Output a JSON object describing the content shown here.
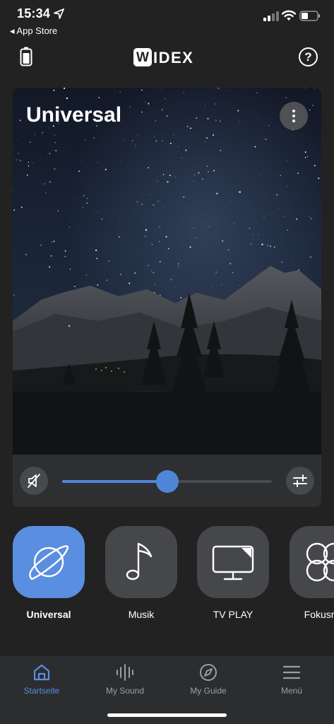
{
  "status_bar": {
    "time": "15:34",
    "back_app": "◂ App Store",
    "icons": [
      "location-arrow-icon",
      "cellular-signal-icon",
      "wifi-icon",
      "battery-icon"
    ]
  },
  "header": {
    "logo_initial": "W",
    "logo_text": "IDEX",
    "help_label": "?",
    "icons": [
      "hearing-aid-battery-icon",
      "help-icon"
    ]
  },
  "program_card": {
    "title": "Universal",
    "volume_level": 0.5,
    "icons": [
      "more-vertical-icon",
      "speaker-mute-icon",
      "equalizer-sliders-icon"
    ]
  },
  "programs": [
    {
      "label": "Universal",
      "icon": "planet-icon",
      "active": true
    },
    {
      "label": "Musik",
      "icon": "music-note-icon",
      "active": false
    },
    {
      "label": "TV PLAY",
      "icon": "tv-icon",
      "active": false
    },
    {
      "label": "Fokusrich",
      "icon": "focus-icon",
      "active": false
    }
  ],
  "nav": {
    "items": [
      {
        "label": "Startseite",
        "icon": "home-icon",
        "active": true
      },
      {
        "label": "My Sound",
        "icon": "sound-wave-icon",
        "active": false
      },
      {
        "label": "My Guide",
        "icon": "compass-icon",
        "active": false
      },
      {
        "label": "Menü",
        "icon": "menu-icon",
        "active": false
      }
    ]
  },
  "colors": {
    "accent": "#5a8ee0",
    "background": "#222223",
    "tile": "#46474a"
  }
}
